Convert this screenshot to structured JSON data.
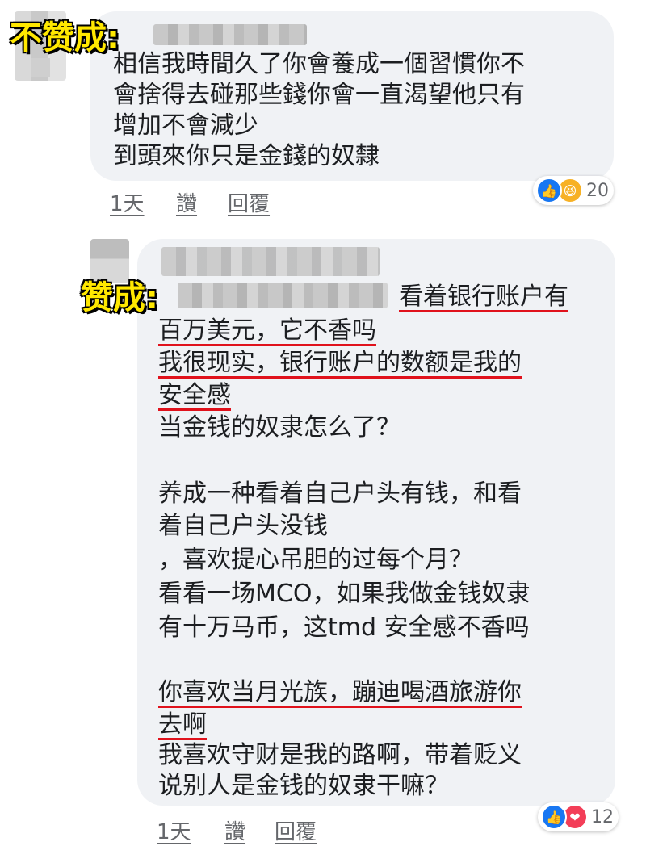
{
  "comment1": {
    "tag": "不赞成:",
    "lines": [
      "相信我時間久了你會養成一個習慣你不",
      "會捨得去碰那些錢你會一直渴望他只有",
      "增加不會減少",
      "到頭來你只是金錢的奴隸"
    ],
    "time": "1天",
    "like_label": "讚",
    "reply_label": "回覆",
    "reactions": {
      "icons": [
        "like-icon",
        "haha-icon"
      ],
      "count": "20"
    }
  },
  "comment2": {
    "tag": "赞成:",
    "lines": [
      "看着银行账户有",
      "百万美元，它不香吗",
      "我很现实，银行账户的数额是我的",
      "安全感",
      "当金钱的奴隶怎么了？",
      "",
      "养成一种看着自己户头有钱，和看",
      "着自己户头没钱",
      "，喜欢提心吊胆的过每个月？",
      "看看一场MCO，如果我做金钱奴隶",
      "有十万马币，这tmd 安全感不香吗",
      "",
      "你喜欢当月光族，蹦迪喝酒旅游你",
      "去啊",
      "我喜欢守财是我的路啊，带着贬义",
      "说别人是金钱的奴隶干嘛？"
    ],
    "time": "1天",
    "like_label": "讚",
    "reply_label": "回覆",
    "reactions": {
      "icons": [
        "like-icon",
        "love-icon"
      ],
      "count": "12"
    }
  },
  "colors": {
    "bubble": "#f0f2f5",
    "underline": "#e0121c",
    "tag_fill": "#ffe800",
    "like_blue": "#1877f2"
  }
}
